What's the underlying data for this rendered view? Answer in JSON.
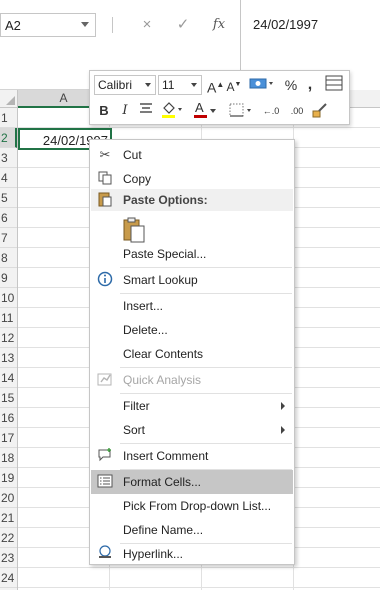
{
  "namebox": {
    "value": "A2"
  },
  "formula_bar": {
    "cancel_icon": "×",
    "enter_icon": "✓",
    "fx_label": "fx",
    "value": "24/02/1997"
  },
  "grid": {
    "column_header": "A",
    "active_cell_value": "24/02/1997",
    "rows": [
      "1",
      "2",
      "3",
      "4",
      "5",
      "6",
      "7",
      "8",
      "9",
      "10",
      "11",
      "12",
      "13",
      "14",
      "15",
      "16",
      "17",
      "18",
      "19",
      "20",
      "21",
      "22",
      "23",
      "24"
    ]
  },
  "mini_toolbar": {
    "font_name": "Calibri",
    "font_size": "11",
    "increase_font": "A",
    "decrease_font": "A",
    "percent": "%",
    "comma": ",",
    "bold": "B",
    "italic": "I",
    "font_color_letter": "A",
    "increase_decimal": "←.0",
    "decrease_decimal": ".00",
    "colors": {
      "highlight": "#ffff00",
      "font": "#c00000"
    }
  },
  "context_menu": {
    "cut": "Cut",
    "copy": "Copy",
    "paste_options": "Paste Options:",
    "paste_special": "Paste Special...",
    "smart_lookup": "Smart Lookup",
    "insert": "Insert...",
    "delete": "Delete...",
    "clear_contents": "Clear Contents",
    "quick_analysis": "Quick Analysis",
    "filter": "Filter",
    "sort": "Sort",
    "insert_comment": "Insert Comment",
    "format_cells": "Format Cells...",
    "pick_from_list": "Pick From Drop-down List...",
    "define_name": "Define Name...",
    "hyperlink": "Hyperlink..."
  },
  "colors": {
    "accent": "#217346",
    "menu_highlight": "#c6c6c6"
  }
}
